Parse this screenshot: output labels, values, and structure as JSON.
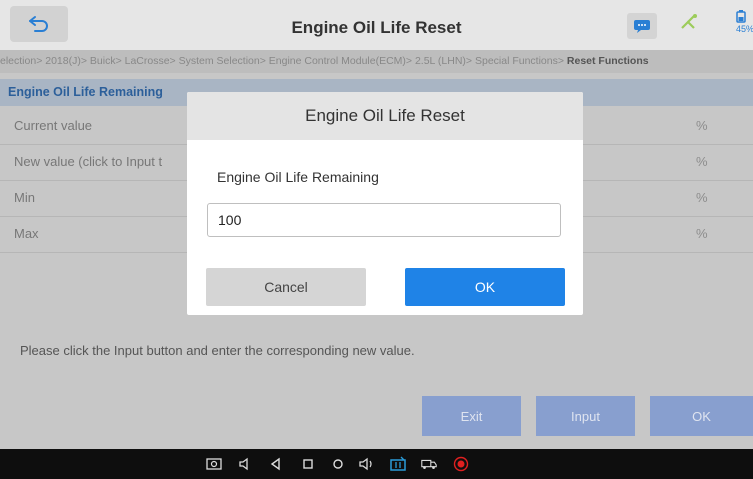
{
  "header": {
    "title": "Engine Oil Life Reset",
    "battery_percent": "45"
  },
  "breadcrumb": {
    "path": "election> 2018(J)> Buick> LaCrosse> System Selection> Engine Control Module(ECM)> 2.5L (LHN)> Special Functions> ",
    "current": "Reset Functions"
  },
  "table": {
    "header_label": "Engine Oil Life Remaining",
    "rows": [
      {
        "label": "Current value",
        "unit": "%"
      },
      {
        "label": "New value (click to Input t",
        "unit": "%"
      },
      {
        "label": "Min",
        "unit": "%"
      },
      {
        "label": "Max",
        "unit": "%"
      }
    ]
  },
  "instruction": "Please click the Input button and enter the corresponding new value.",
  "bottom_buttons": {
    "exit": "Exit",
    "input": "Input",
    "ok": "OK"
  },
  "dialog": {
    "title": "Engine Oil Life Reset",
    "field_label": "Engine Oil Life Remaining",
    "input_value": "100",
    "cancel_label": "Cancel",
    "ok_label": "OK"
  },
  "icons": {
    "back": "back-arrow-icon",
    "message": "message-icon",
    "status": "wifi-icon",
    "battery": "battery-icon"
  },
  "colors": {
    "accent": "#1f83e7",
    "header_blue": "#2c5f9a",
    "bottom_button": "#889fcf"
  }
}
